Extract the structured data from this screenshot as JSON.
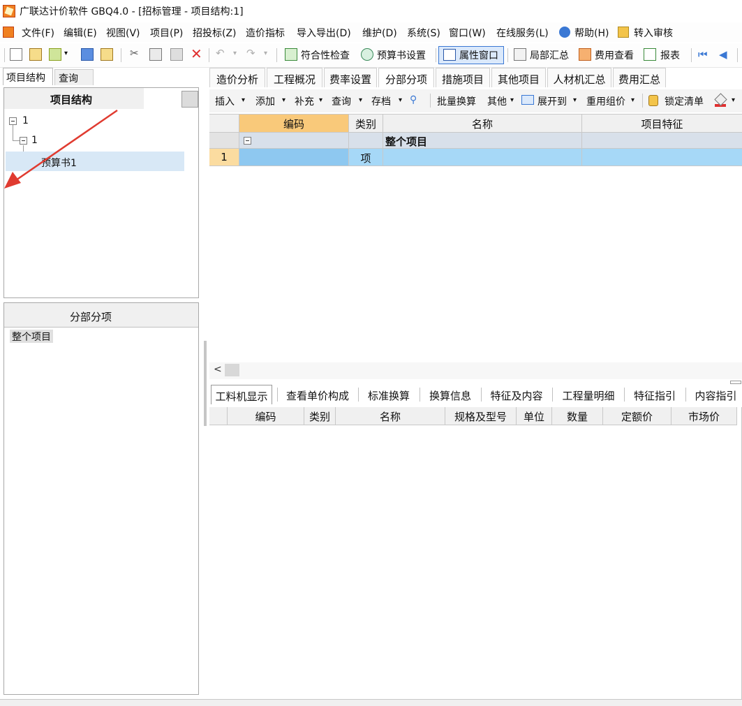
{
  "window": {
    "title": "广联达计价软件 GBQ4.0 - [招标管理 - 项目结构:1]"
  },
  "menu": [
    "文件(F)",
    "编辑(E)",
    "视图(V)",
    "项目(P)",
    "招投标(Z)",
    "造价指标",
    "导入导出(D)",
    "维护(D)",
    "系统(S)",
    "窗口(W)",
    "在线服务(L)",
    "帮助(H)",
    "转入审核"
  ],
  "toolbar": {
    "compliance_check": "符合性检查",
    "budget_settings": "预算书设置",
    "property_window": "属性窗口",
    "partial_summary": "局部汇总",
    "cost_view": "费用查看",
    "report": "报表"
  },
  "left_tabs": [
    "项目结构",
    "查询"
  ],
  "tree": {
    "header": "项目结构",
    "nodes": [
      "1",
      "1",
      "预算书1"
    ]
  },
  "section_panel": {
    "header": "分部分项",
    "items": [
      "整个项目"
    ]
  },
  "main_tabs": [
    "造价分析",
    "工程概况",
    "费率设置",
    "分部分项",
    "措施项目",
    "其他项目",
    "人材机汇总",
    "费用汇总"
  ],
  "sub_toolbar": {
    "insert": "插入",
    "add": "添加",
    "supplement": "补充",
    "query": "查询",
    "archive": "存档",
    "batch_convert": "批量换算",
    "other": "其他",
    "expand_to": "展开到",
    "reuse_price": "重用组价",
    "lock_list": "锁定清单"
  },
  "grid": {
    "columns": [
      "编码",
      "类别",
      "名称",
      "项目特征"
    ],
    "group_row": {
      "name": "整个项目"
    },
    "rows": [
      {
        "num": "1",
        "code": "",
        "type": "项",
        "name": "",
        "feature": ""
      }
    ]
  },
  "bottom_tabs": [
    "工料机显示",
    "查看单价构成",
    "标准换算",
    "换算信息",
    "特征及内容",
    "工程量明细",
    "特征指引",
    "内容指引"
  ],
  "bottom_grid": {
    "columns": [
      "编码",
      "类别",
      "名称",
      "规格及型号",
      "单位",
      "数量",
      "定额价",
      "市场价"
    ]
  },
  "colors": {
    "selected_header": "#f9c97a",
    "selected_row": "#a6d8f7",
    "tree_highlight": "#d8e8f6",
    "arrow": "#e03b30"
  }
}
